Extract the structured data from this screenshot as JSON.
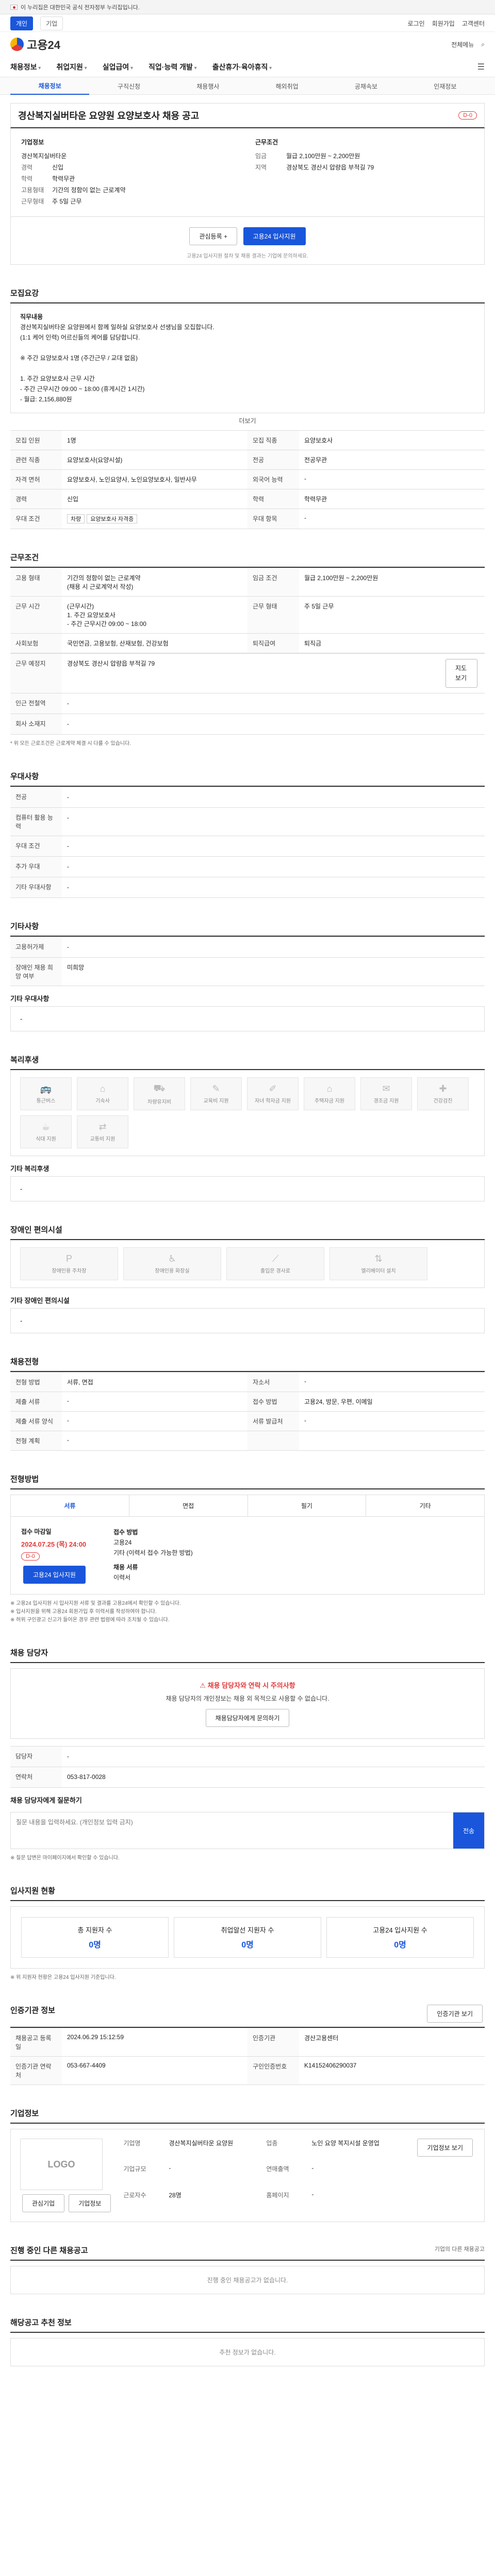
{
  "gov_banner": {
    "text": "이 누리집은 대한민국 공식 전자정부 누리집입니다."
  },
  "util": {
    "tabs": [
      "개인",
      "기업"
    ],
    "links": [
      "로그인",
      "회원가입",
      "고객센터"
    ]
  },
  "header": {
    "logo": "고용24",
    "right_links": [
      "전체메뉴",
      "검색"
    ]
  },
  "gnb": {
    "items": [
      "채용정보",
      "취업지원",
      "실업급여",
      "직업·능력 개발",
      "출산휴가·육아휴직"
    ]
  },
  "subnav": {
    "items": [
      "채용정보",
      "구직신청",
      "채용행사",
      "해외취업",
      "공채속보",
      "인재정보"
    ]
  },
  "title": {
    "text": "경산복지실버타운 요양원 요양보호사 채용 공고",
    "badge": "D-0"
  },
  "summary": {
    "company_label": "기업정보",
    "company_name": "경산복지실버타운",
    "left": [
      {
        "k": "경력",
        "v": "신입"
      },
      {
        "k": "학력",
        "v": "학력무관"
      },
      {
        "k": "고용형태",
        "v": "기간의 정함이 없는 근로계약"
      },
      {
        "k": "근무형태",
        "v": "주 5일 근무"
      }
    ],
    "cond_label": "근무조건",
    "right": [
      {
        "k": "임금",
        "v": "월급 2,100만원 ~ 2,200만원"
      },
      {
        "k": "지역",
        "v": "경상북도 경산시 압량읍 부적길 79"
      }
    ]
  },
  "actions": {
    "fav": "관심등록 +",
    "apply": "고용24 입사지원",
    "note": "고용24 입사지원 절차 및 채용 결과는 기업에 문의하세요."
  },
  "sec_recruit": {
    "title": "모집요강",
    "duty_label": "직무내용",
    "duty": "경산복지실버타운 요양원에서 함께 일하실 요양보호사 선생님을 모집합니다.\n(1:1 케어 인력) 어르신들의 케어를 담당합니다.\n\n※ 주간 요양보호사 1명 (주간근무 / 교대 없음)\n\n1. 주간 요양보호사 근무 시간\n- 주간 근무시간 09:00 ~ 18:00 (휴게시간 1시간)\n- 월급: 2,156,880원",
    "more": "더보기",
    "grid": [
      {
        "k": "모집 인원",
        "v": "1명"
      },
      {
        "k": "모집 직종",
        "v": "요양보호사"
      },
      {
        "k": "관련 직종",
        "v": "요양보호사(요양시설)"
      },
      {
        "k": "전공",
        "v": "전공무관"
      },
      {
        "k": "자격 면허",
        "v": "요양보호사, 노인요양사, 노인요양보호사, 일반사무"
      },
      {
        "k": "외국어 능력",
        "v": "-"
      },
      {
        "k": "경력",
        "v": "신입"
      },
      {
        "k": "학력",
        "v": "학력무관"
      },
      {
        "k": "우대 조건",
        "v": "우대사항"
      },
      {
        "k": "우대 항목",
        "v": "-"
      }
    ],
    "tags": [
      "차량",
      "요양보호사 자격증"
    ]
  },
  "sec_cond": {
    "title": "근무조건",
    "rows": [
      {
        "k": "고용 형태",
        "v": "기간의 정함이 없는 근로계약\n(채용 시 근로계약서 작성)"
      },
      {
        "k": "임금 조건",
        "v": "월급 2,100만원 ~ 2,200만원"
      },
      {
        "k": "근무 시간",
        "v": "(근무시간)\n1. 주간 요양보호사\n- 주간 근무시간 09:00 ~ 18:00"
      },
      {
        "k": "근무 형태",
        "v": "주 5일 근무"
      },
      {
        "k": "사회보험",
        "v": "국민연금, 고용보험, 산재보험, 건강보험"
      },
      {
        "k": "퇴직급여",
        "v": "퇴직금"
      },
      {
        "k": "근무 예정지",
        "v": "경상북도 경산시 압량읍 부적길 79"
      },
      {
        "k": "인근 전철역",
        "v": "-"
      },
      {
        "k": "회사 소재지",
        "v": "-"
      }
    ],
    "map_btn": "지도 보기",
    "note": "* 위 모든 근로조건은 근로계약 체결 시 다를 수 있습니다."
  },
  "sec_preference": {
    "title": "우대사항",
    "rows": [
      {
        "k": "전공",
        "v": "-"
      },
      {
        "k": "컴퓨터 활용 능력",
        "v": "-"
      },
      {
        "k": "우대 조건",
        "v": "-"
      },
      {
        "k": "추가 우대",
        "v": "-"
      },
      {
        "k": "기타 우대사항",
        "v": "-"
      }
    ]
  },
  "sec_etc": {
    "title": "기타사항",
    "rows": [
      {
        "k": "고용허가제",
        "v": "-"
      },
      {
        "k": "장애인 채용 희망 여부",
        "v": "미희망"
      }
    ],
    "extra_label": "기타 우대사항",
    "extra_value": "-"
  },
  "sec_welfare": {
    "title": "복리후생",
    "items": [
      "통근버스",
      "기숙사",
      "차량유지비",
      "교육비 지원",
      "자녀 학자금 지원",
      "주택자금 지원",
      "경조금 지원",
      "건강검진",
      "식대 지원",
      "교통비 지원"
    ],
    "other_label": "기타 복리후생",
    "other_value": "-"
  },
  "sec_disabled": {
    "title": "장애인 편의시설",
    "items": [
      "장애인용 주차장",
      "장애인용 화장실",
      "출입문 경사로",
      "엘리베이터 설치"
    ],
    "other_label": "기타 장애인 편의시설",
    "other_value": "-"
  },
  "sec_process": {
    "title": "채용전형",
    "rows": [
      {
        "k": "전형 방법",
        "v": "서류, 면접"
      },
      {
        "k": "자소서",
        "v": "-"
      },
      {
        "k": "제출 서류",
        "v": "-"
      },
      {
        "k": "접수 방법",
        "v": "고용24, 방문, 우편, 이메일"
      }
    ],
    "rows2": [
      {
        "k": "제출 서류 양식",
        "v": "-"
      },
      {
        "k": "서류 발급처",
        "v": "-"
      },
      {
        "k": "전형 계획",
        "v": "-"
      }
    ]
  },
  "sec_apply": {
    "title": "전형방법",
    "tabs": [
      "서류",
      "면접",
      "필기",
      "기타"
    ],
    "deadline_label": "접수 마감일",
    "deadline": "2024.07.25 (목) 24:00",
    "deadline_badge": "D-0",
    "apply_btn": "고용24 입사지원",
    "method_label": "접수 방법",
    "method": "고용24\n기타 (이력서 접수 가능한 방법)",
    "form_label": "채용 서류",
    "form": "이력서",
    "notes": "※ 고용24 입사지원 시 입사지원 서류 및 결과를 고용24에서 확인할 수 있습니다.\n※ 입사지원을 위해 고용24 회원가입 후 이력서를 작성하여야 합니다.\n※ 허위 구인광고 신고가 들어온 경우 관련 법령에 따라 조치될 수 있습니다."
  },
  "sec_manager": {
    "title": "채용 담당자",
    "warn": "채용 담당자와 연락 시 주의사항",
    "warn_text": "채용 담당자의 개인정보는 채용 외 목적으로 사용할 수 없습니다.",
    "contact_btn": "채용담당자에게 문의하기",
    "rows": [
      {
        "k": "담당자",
        "v": "-"
      },
      {
        "k": "연락처",
        "v": "053-817-0028"
      }
    ],
    "qa_label": "채용 담당자에게 질문하기",
    "qa_placeholder": "질문 내용을 입력하세요. (개인정보 입력 금지)",
    "qa_send": "전송",
    "qa_note": "※ 질문 답변은 마이페이지에서 확인할 수 있습니다."
  },
  "sec_stats": {
    "title": "입사지원 현황",
    "items": [
      {
        "k": "총 지원자 수",
        "v": "0명"
      },
      {
        "k": "취업알선 지원자 수",
        "v": "0명"
      },
      {
        "k": "고용24 입사지원 수",
        "v": "0명"
      }
    ],
    "note": "※ 위 지원자 현황은 고용24 입사지원 기준입니다."
  },
  "sec_agency": {
    "title": "인증기관 정보",
    "btn": "인증기관 보기",
    "rows": [
      {
        "k": "채용공고 등록일",
        "v": "2024.06.29 15:12:59"
      },
      {
        "k": "인증기관",
        "v": "경산고용센터"
      },
      {
        "k": "인증기관 연락처",
        "v": "053-667-4409"
      },
      {
        "k": "구인인증번호",
        "v": "K14152406290037"
      }
    ]
  },
  "sec_corp": {
    "title": "기업정보",
    "logo_text": "LOGO",
    "btn1": "관심기업",
    "btn2": "기업정보",
    "rows": [
      {
        "k": "기업명",
        "v": "경산복지실버타운 요양원"
      },
      {
        "k": "업종",
        "v": "노인 요양 복지시설 운영업"
      },
      {
        "k": "기업규모",
        "v": "-"
      },
      {
        "k": "연매출액",
        "v": "-"
      },
      {
        "k": "근로자수",
        "v": "28명"
      },
      {
        "k": "홈페이지",
        "v": "-"
      }
    ],
    "view_btn": "기업정보 보기"
  },
  "sec_related": {
    "title": "진행 중인 다른 채용공고",
    "empty": "진행 중인 채용공고가 없습니다.",
    "more": "기업의 다른 채용공고"
  },
  "sec_reco": {
    "title": "해당공고 추천 정보",
    "empty": "추천 정보가 없습니다."
  }
}
